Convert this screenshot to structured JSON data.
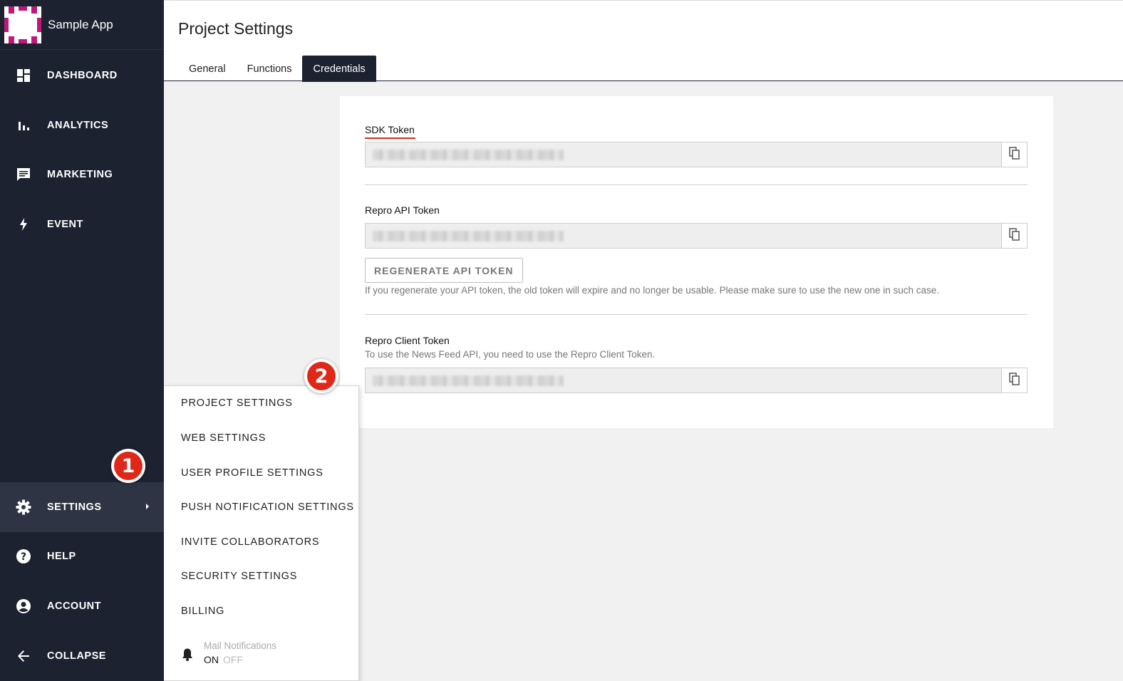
{
  "app": {
    "name": "Sample App"
  },
  "sidebar": {
    "items": [
      {
        "label": "DASHBOARD",
        "icon": "dashboard-icon"
      },
      {
        "label": "ANALYTICS",
        "icon": "bar-chart-icon"
      },
      {
        "label": "MARKETING",
        "icon": "chat-icon"
      },
      {
        "label": "EVENT",
        "icon": "lightning-icon"
      },
      {
        "label": "SETTINGS",
        "icon": "gear-icon",
        "active": true
      },
      {
        "label": "HELP",
        "icon": "help-icon"
      },
      {
        "label": "ACCOUNT",
        "icon": "account-icon"
      },
      {
        "label": "COLLAPSE",
        "icon": "arrow-left-icon"
      }
    ]
  },
  "header": {
    "title": "Project Settings",
    "tabs": [
      {
        "label": "General"
      },
      {
        "label": "Functions"
      },
      {
        "label": "Credentials",
        "active": true
      }
    ]
  },
  "credentials": {
    "sdk_token": {
      "label": "SDK Token"
    },
    "api_token": {
      "label": "Repro API Token",
      "regenerate_label": "REGENERATE API TOKEN",
      "warning": "If you regenerate your API token, the old token will expire and no longer be usable. Please make sure to use the new one in such case."
    },
    "client_token": {
      "label": "Repro Client Token",
      "description": "To use the News Feed API, you need to use the Repro Client Token."
    }
  },
  "settings_menu": {
    "items": [
      {
        "label": "PROJECT SETTINGS"
      },
      {
        "label": "WEB SETTINGS"
      },
      {
        "label": "USER PROFILE SETTINGS"
      },
      {
        "label": "PUSH NOTIFICATION SETTINGS"
      },
      {
        "label": "INVITE COLLABORATORS"
      },
      {
        "label": "SECURITY SETTINGS"
      },
      {
        "label": "BILLING"
      }
    ],
    "mail_notifications": {
      "label": "Mail Notifications",
      "on": "ON",
      "off": "OFF"
    }
  },
  "annotations": {
    "step1": "1",
    "step2": "2"
  },
  "colors": {
    "sidebar_bg": "#1c2230",
    "accent_red": "#e0261e",
    "logo_magenta": "#c2177a"
  }
}
